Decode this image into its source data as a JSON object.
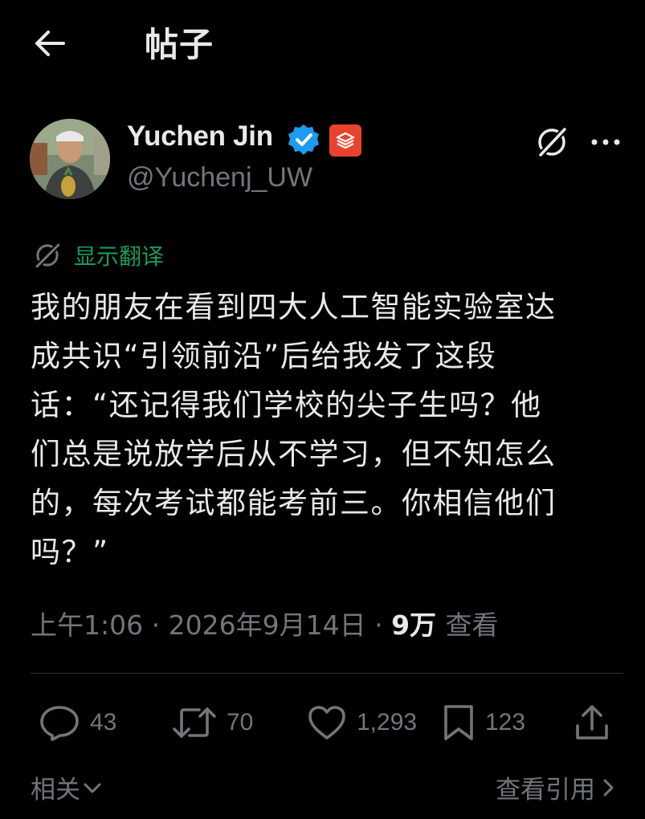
{
  "header": {
    "title": "帖子",
    "back_icon": "arrow-left-icon"
  },
  "author": {
    "name": "Yuchen Jin",
    "handle": "@Yuchenj_UW",
    "verified_color": "#1d9bf0",
    "org_badge_color": "#e8432f"
  },
  "translate": {
    "label": "显示翻译",
    "color": "#1a9a59"
  },
  "post": {
    "lines": [
      "我的朋友在看到四大人工智能实验室达",
      "成共识“引领前沿”后给我发了这段",
      "话：“还记得我们学校的尖子生吗？他",
      "们总是说放学后从不学习，但不知怎么",
      "的，每次考试都能考前三。你相信他们",
      "吗？”"
    ]
  },
  "meta": {
    "time": "上午1:06",
    "date": "2026年9月14日",
    "views_count": "9万",
    "views_label": "查看",
    "separator": "·"
  },
  "actions": {
    "replies": "43",
    "reposts": "70",
    "likes": "1,293",
    "bookmarks": "123"
  },
  "footer": {
    "related": "相关",
    "view_quotes": "查看引用"
  },
  "colors": {
    "background": "#000000",
    "text": "#e7e9ea",
    "muted": "#71767b",
    "divider": "#2f3336"
  }
}
